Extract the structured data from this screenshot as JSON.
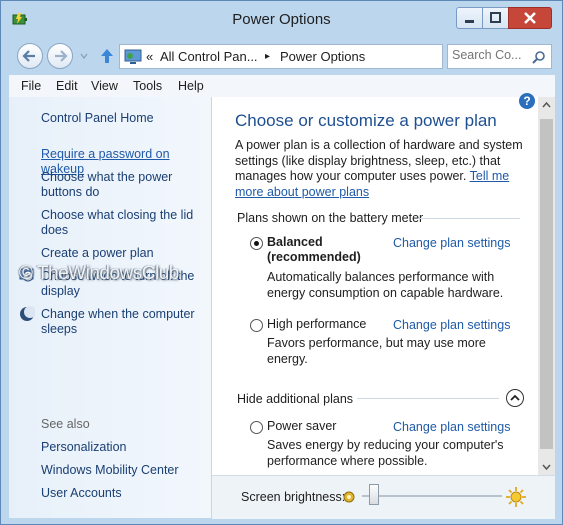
{
  "window": {
    "title": "Power Options",
    "accent": "#1e4f8f",
    "link_color": "#1f5aa8"
  },
  "address": {
    "separator": "«",
    "crumb1": "All Control Pan...",
    "arrow": "▸",
    "crumb2": "Power Options",
    "search_placeholder": "Search Co..."
  },
  "menu": {
    "file": "File",
    "edit": "Edit",
    "view": "View",
    "tools": "Tools",
    "help": "Help"
  },
  "sidebar": {
    "home": "Control Panel Home",
    "items": [
      {
        "label": "Require a password on wakeup"
      },
      {
        "label": "Choose what the power buttons do"
      },
      {
        "label": "Choose what closing the lid does"
      },
      {
        "label": "Create a power plan"
      },
      {
        "label": "Choose when to turn off the display",
        "icon": "display-clock-icon"
      },
      {
        "label": "Change when the computer sleeps",
        "icon": "moon-icon"
      }
    ],
    "see_also": "See also",
    "see_also_items": [
      {
        "label": "Personalization"
      },
      {
        "label": "Windows Mobility Center"
      },
      {
        "label": "User Accounts"
      }
    ],
    "watermark": "© TheWindowsClub"
  },
  "main": {
    "heading": "Choose or customize a power plan",
    "description": "A power plan is a collection of hardware and system settings (like display brightness, sleep, etc.) that manages how your computer uses power.",
    "tell_me_link": "Tell me more about power plans",
    "battery_section": "Plans shown on the battery meter",
    "hide_section": "Hide additional plans",
    "plans": [
      {
        "name": "Balanced (recommended)",
        "selected": true,
        "change": "Change plan settings",
        "desc": "Automatically balances performance with energy consumption on capable hardware."
      },
      {
        "name": "High performance",
        "selected": false,
        "change": "Change plan settings",
        "desc": "Favors performance, but may use more energy."
      },
      {
        "name": "Power saver",
        "selected": false,
        "change": "Change plan settings",
        "desc": "Saves energy by reducing your computer's performance where possible."
      }
    ]
  },
  "bottom": {
    "brightness_label": "Screen brightness:",
    "brightness_level": 0.05
  }
}
